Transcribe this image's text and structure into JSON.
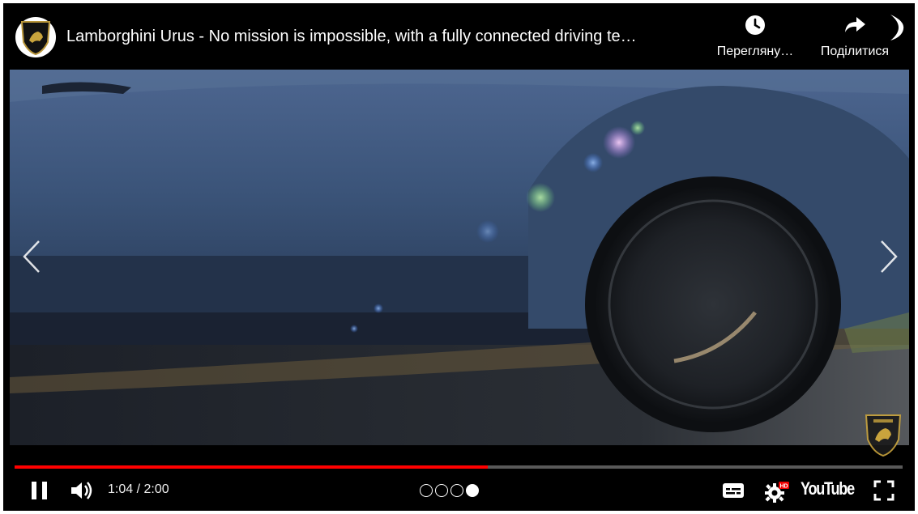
{
  "player": {
    "title": "Lamborghini Urus - No mission is impossible, with a fully connected driving te…",
    "channel_icon": "lamborghini-shield-icon",
    "actions": {
      "watch_later_label": "Перегляну…",
      "watch_later_icon": "clock-icon",
      "share_label": "Поділитися",
      "share_icon": "share-arrow-icon"
    },
    "navigation": {
      "prev_icon": "chevron-left-icon",
      "next_icon": "chevron-right-icon"
    },
    "watermark_icon": "lamborghini-shield-icon"
  },
  "controls": {
    "current_time": "1:04 / 2:00",
    "progress_fraction": 0.533,
    "pager": {
      "count": 4,
      "active_index": 3
    },
    "subtitles_icon": "subtitles-icon",
    "settings_icon": "gear-icon",
    "settings_badge": "HD",
    "logo_text": "YouTube",
    "fullscreen_icon": "fullscreen-icon",
    "pause_icon": "pause-icon",
    "volume_icon": "volume-icon"
  },
  "colors": {
    "progress_played": "#ff0000",
    "background": "#000000",
    "accent_text": "#ffffff"
  }
}
